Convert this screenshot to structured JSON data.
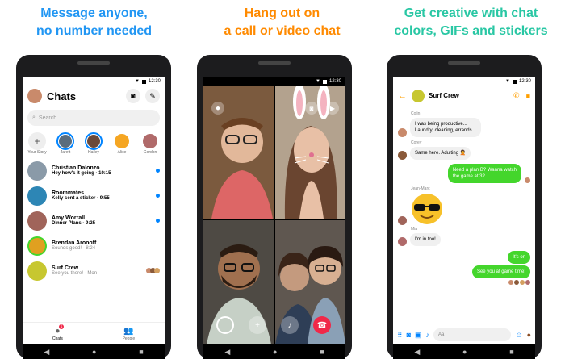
{
  "captions": [
    {
      "line1": "Message anyone,",
      "line2": "no number needed",
      "color": "#2196f3"
    },
    {
      "line1": "Hang out on",
      "line2": "a call or video chat",
      "color": "#ff8a00"
    },
    {
      "line1": "Get creative with chat",
      "line2": "colors, GIFs and stickers",
      "color": "#29c7a4"
    }
  ],
  "status": {
    "time": "12:30"
  },
  "phone1": {
    "title": "Chats",
    "search_placeholder": "Search",
    "stories": [
      {
        "label": "Your Story"
      },
      {
        "label": "Jarett"
      },
      {
        "label": "Hailey"
      },
      {
        "label": "Alice"
      },
      {
        "label": "Gordon"
      }
    ],
    "chats": [
      {
        "name": "Christian Dalonzo",
        "message": "Hey how's it going",
        "time": "· 10:15",
        "unread": true
      },
      {
        "name": "Roommates",
        "message": "Kelly sent a sticker",
        "time": "· 9:55",
        "unread": true
      },
      {
        "name": "Amy Worrall",
        "message": "Dinner Plans",
        "time": "· 9:25",
        "unread": true
      },
      {
        "name": "Brendan Aronoff",
        "message": "Sounds good!",
        "time": "· 8:24",
        "unread": false
      },
      {
        "name": "Surf Crew",
        "message": "See you there!",
        "time": "· Mon",
        "unread": false
      }
    ],
    "tabs": [
      {
        "label": "Chats"
      },
      {
        "label": "People"
      }
    ],
    "chats_badge": "1"
  },
  "phone3": {
    "thread_title": "Surf Crew",
    "messages": [
      {
        "sender": "Colin",
        "text_lines": [
          "I was being productive...",
          "Laundry, cleaning, errands..."
        ],
        "direction": "in"
      },
      {
        "sender": "Corey",
        "text_lines": [
          "Same here. Adulting 🤦"
        ],
        "direction": "in"
      },
      {
        "sender": "",
        "text_lines": [
          "Need a plan B? Wanna watch",
          "the game at 3?"
        ],
        "direction": "out"
      },
      {
        "sender": "Jean-Marc",
        "text_lines": [],
        "direction": "in",
        "sticker": "cool-face-sticker"
      },
      {
        "sender": "Mia",
        "text_lines": [
          "I'm in too!"
        ],
        "direction": "in"
      },
      {
        "sender": "",
        "text_lines": [
          "It's on"
        ],
        "direction": "out"
      },
      {
        "sender": "",
        "text_lines": [
          "See you at game time!"
        ],
        "direction": "out"
      }
    ],
    "composer_placeholder": "Aa"
  },
  "colors": {
    "messenger_blue": "#0084ff",
    "surf_crew_accent": "#ff9f00",
    "outgoing_bubble": "#44d62c",
    "end_call": "#f02849"
  }
}
